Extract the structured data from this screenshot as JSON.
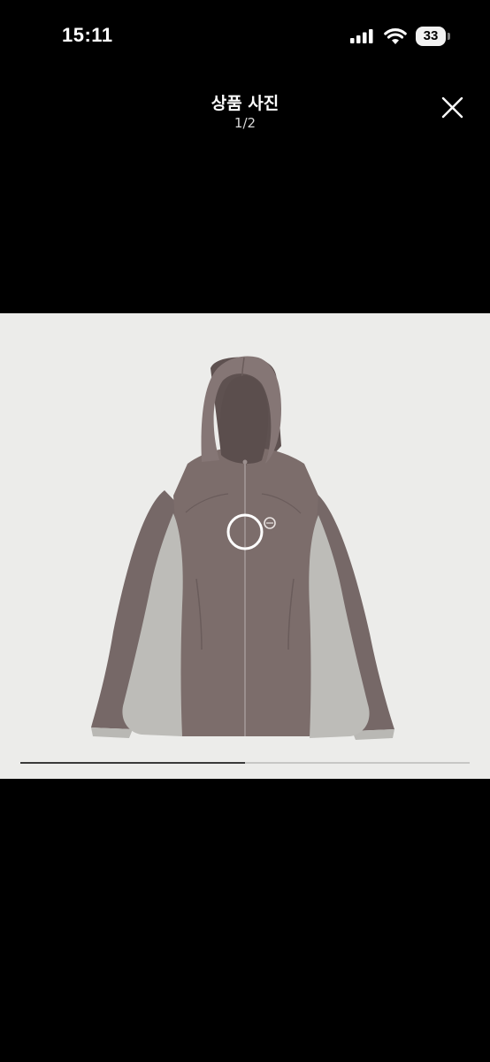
{
  "status_bar": {
    "time": "15:11",
    "battery_level": "33",
    "icons": [
      "signal-icon",
      "wifi-icon",
      "battery-icon"
    ]
  },
  "header": {
    "title": "상품 사진",
    "counter": "1/2",
    "close_icon": "close-icon"
  },
  "photo": {
    "subject": "hooded windbreaker jacket",
    "colors": {
      "background": "#ececea",
      "body": "#7c6d6b",
      "panels": "#bdbcb8"
    }
  },
  "carousel": {
    "current": 1,
    "total": 2,
    "progress": 0.5
  }
}
